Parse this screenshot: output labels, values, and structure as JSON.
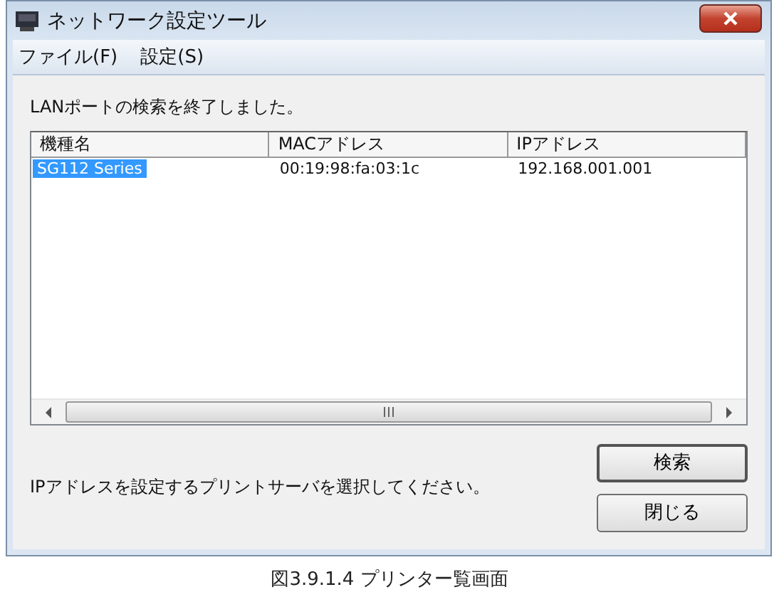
{
  "window": {
    "title": "ネットワーク設定ツール"
  },
  "menu": [
    {
      "label": "ファイル(F)"
    },
    {
      "label": "設定(S)"
    }
  ],
  "status_message": "LANポートの検索を終了しました。",
  "table": {
    "columns": [
      "機種名",
      "MACアドレス",
      "IPアドレス"
    ],
    "rows": [
      {
        "cells": [
          "SG112 Series",
          "00:19:98:fa:03:1c",
          "192.168.001.001"
        ],
        "selected": true
      }
    ]
  },
  "instruction": "IPアドレスを設定するプリントサーバを選択してください。",
  "buttons": [
    {
      "label": "検索"
    },
    {
      "label": "閉じる"
    }
  ],
  "caption": "図3.9.1.4 プリンター覧画面"
}
